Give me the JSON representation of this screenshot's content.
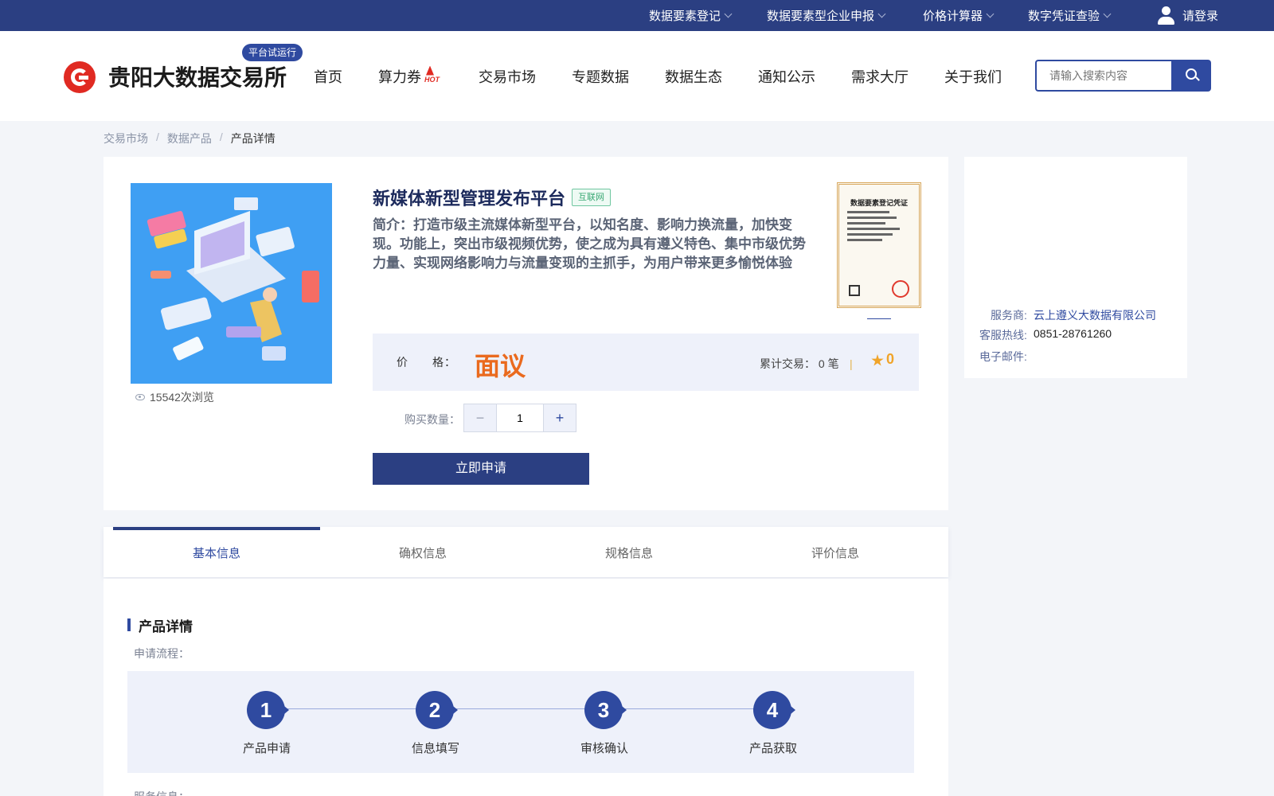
{
  "topbar": {
    "items": [
      {
        "label": "数据要素登记"
      },
      {
        "label": "数据要素型企业申报"
      },
      {
        "label": "价格计算器"
      },
      {
        "label": "数字凭证查验"
      }
    ],
    "login": "请登录"
  },
  "header": {
    "logo_text": "贵阳大数据交易所",
    "trial_badge": "平台试运行",
    "nav": [
      "首页",
      "算力券",
      "交易市场",
      "专题数据",
      "数据生态",
      "通知公示",
      "需求大厅",
      "关于我们"
    ],
    "hot_badge": "HOT",
    "search_placeholder": "请输入搜索内容"
  },
  "breadcrumb": [
    "交易市场",
    "数据产品",
    "产品详情"
  ],
  "product": {
    "title": "新媒体新型管理发布平台",
    "tag": "互联网",
    "intro": "简介：打造市级主流媒体新型平台，以知名度、影响力换流量，加快变现。功能上，突出市级视频优势，使之成为具有遵义特色、集中市级优势力量、实现网络影响力与流量变现的主抓手，为用户带来更多愉悦体验",
    "views": "15542次浏览",
    "cert_title": "数据要素登记凭证",
    "price_label": "价　　格：",
    "price_value": "面议",
    "trade_text": "累计交易：  0 笔",
    "rating": "0",
    "qty_label": "购买数量：",
    "qty_value": "1",
    "apply_label": "立即申请"
  },
  "side": {
    "provider_label": "服务商:",
    "provider_value": "云上遵义大数据有限公司",
    "hotline_label": "客服热线:",
    "hotline_value": "0851-28761260",
    "email_label": "电子邮件:"
  },
  "tabs": [
    "基本信息",
    "确权信息",
    "规格信息",
    "评价信息"
  ],
  "details": {
    "section_title": "产品详情",
    "flow_label": "申请流程：",
    "steps": [
      {
        "num": "1",
        "label": "产品申请"
      },
      {
        "num": "2",
        "label": "信息填写"
      },
      {
        "num": "3",
        "label": "审核确认"
      },
      {
        "num": "4",
        "label": "产品获取"
      }
    ],
    "service_label": "服务信息："
  },
  "colors": {
    "primary": "#2b3f82",
    "accent": "#2f4aa0",
    "price": "#ea6a1e",
    "rating": "#f0a429",
    "logo_red": "#e02a22"
  }
}
